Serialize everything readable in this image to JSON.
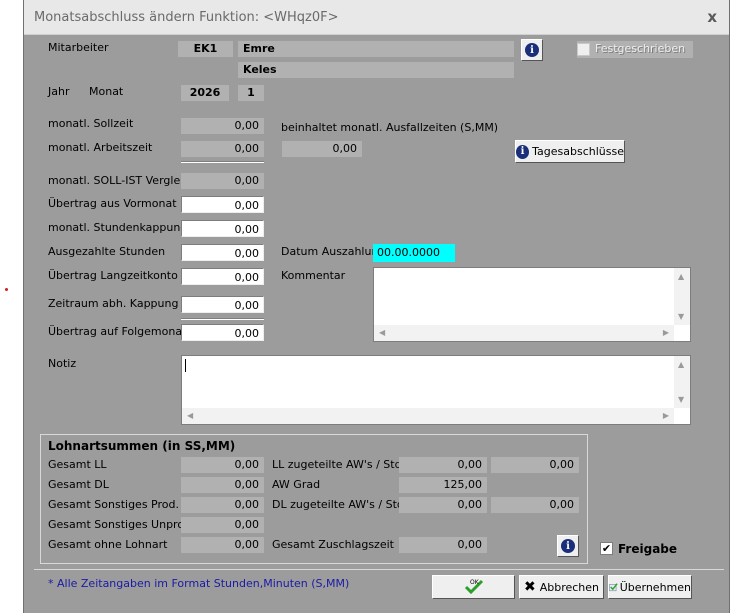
{
  "window": {
    "title": "Monatsabschluss ändern Funktion: <WHqz0F>",
    "close": "x"
  },
  "employee": {
    "label": "Mitarbeiter",
    "code": "EK1",
    "first_name": "Emre",
    "last_name": "Keles"
  },
  "period": {
    "year_label": "Jahr",
    "month_label": "Monat",
    "year": "2026",
    "month": "1"
  },
  "festgeschrieben": {
    "label": "Festgeschrieben",
    "checked": false
  },
  "fields": {
    "sollzeit": {
      "label": "monatl. Sollzeit",
      "value": "0,00"
    },
    "ausfallzeiten_label": "beinhaltet monatl. Ausfallzeiten (S,MM)",
    "arbeitszeit": {
      "label": "monatl. Arbeitszeit",
      "value": "0,00",
      "ausfall_value": "0,00"
    },
    "soll_ist": {
      "label": "monatl. SOLL-IST Vergleich",
      "value": "0,00"
    },
    "uebertrag_vormonat": {
      "label": "Übertrag aus Vormonat",
      "value": "0,00"
    },
    "stundenkappung": {
      "label": "monatl. Stundenkappung",
      "value": "0,00"
    },
    "ausgezahlte_stunden": {
      "label": "Ausgezahlte Stunden",
      "value": "0,00"
    },
    "datum_auszahlung": {
      "label": "Datum Auszahlung",
      "value": "00.00.0000"
    },
    "langzeitkonto": {
      "label": "Übertrag Langzeitkonto",
      "value": "0,00"
    },
    "kommentar_label": "Kommentar",
    "zeitraum_kappung": {
      "label": "Zeitraum abh. Kappung",
      "value": "0,00"
    },
    "folgemonat": {
      "label": "Übertrag auf Folgemonat",
      "value": "0,00"
    },
    "notiz_label": "Notiz"
  },
  "tagesabschluesse_button": "Tagesabschlüsse",
  "lohnart": {
    "title": "Lohnartsummen (in SS,MM)",
    "gesamt_ll": {
      "label": "Gesamt LL",
      "value": "0,00"
    },
    "gesamt_dl": {
      "label": "Gesamt DL",
      "value": "0,00"
    },
    "sonst_prod": {
      "label": "Gesamt Sonstiges Prod.",
      "value": "0,00"
    },
    "sonst_unprod": {
      "label": "Gesamt Sonstiges Unprod.",
      "value": "0,00"
    },
    "ohne_lohnart": {
      "label": "Gesamt ohne Lohnart",
      "value": "0,00"
    },
    "ll_aw": {
      "label": "LL zugeteilte AW's / Std",
      "value1": "0,00",
      "value2": "0,00"
    },
    "aw_grad": {
      "label": "AW Grad",
      "value": "125,00"
    },
    "dl_aw": {
      "label": "DL zugeteilte AW's / Std",
      "value1": "0,00",
      "value2": "0,00"
    },
    "zuschlagszeit": {
      "label": "Gesamt Zuschlagszeit",
      "value": "0,00"
    }
  },
  "freigabe": {
    "label": "Freigabe",
    "checked": true,
    "mark": "✔"
  },
  "footnote": "* Alle Zeitangaben im Format Stunden,Minuten (S,MM)",
  "buttons": {
    "ok": "OK",
    "abbrechen": "Abbrechen",
    "uebernehmen": "Übernehmen"
  },
  "colors": {
    "panel": "#9c9c9c",
    "readonly": "#b1b1b1",
    "date_highlight": "#00ffff",
    "footnote": "#1a1aa8",
    "info_icon": "#1b2e7a"
  }
}
